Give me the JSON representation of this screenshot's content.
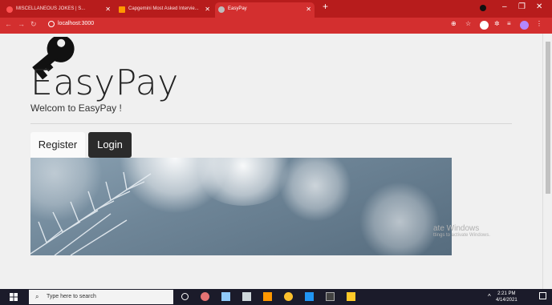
{
  "browser": {
    "tabs": [
      {
        "label": "MISCELLANEOUS JOKES | S..."
      },
      {
        "label": "Capgemini Most Asked Intervie..."
      },
      {
        "label": "EasyPay"
      }
    ],
    "url": "localhost:3000"
  },
  "page": {
    "title": "EasyPay",
    "subtitle": "Welcom to EasyPay !",
    "register_label": "Register",
    "login_label": "Login"
  },
  "watermark": {
    "line1": "ate Windows",
    "line2": "ttings to activate Windows."
  },
  "taskbar": {
    "search_placeholder": "Type here to search",
    "time": "2:21 PM",
    "date": "4/14/2021"
  },
  "colors": {
    "browser_chrome": "#d32f2f",
    "login_button": "#2b2b2b"
  }
}
